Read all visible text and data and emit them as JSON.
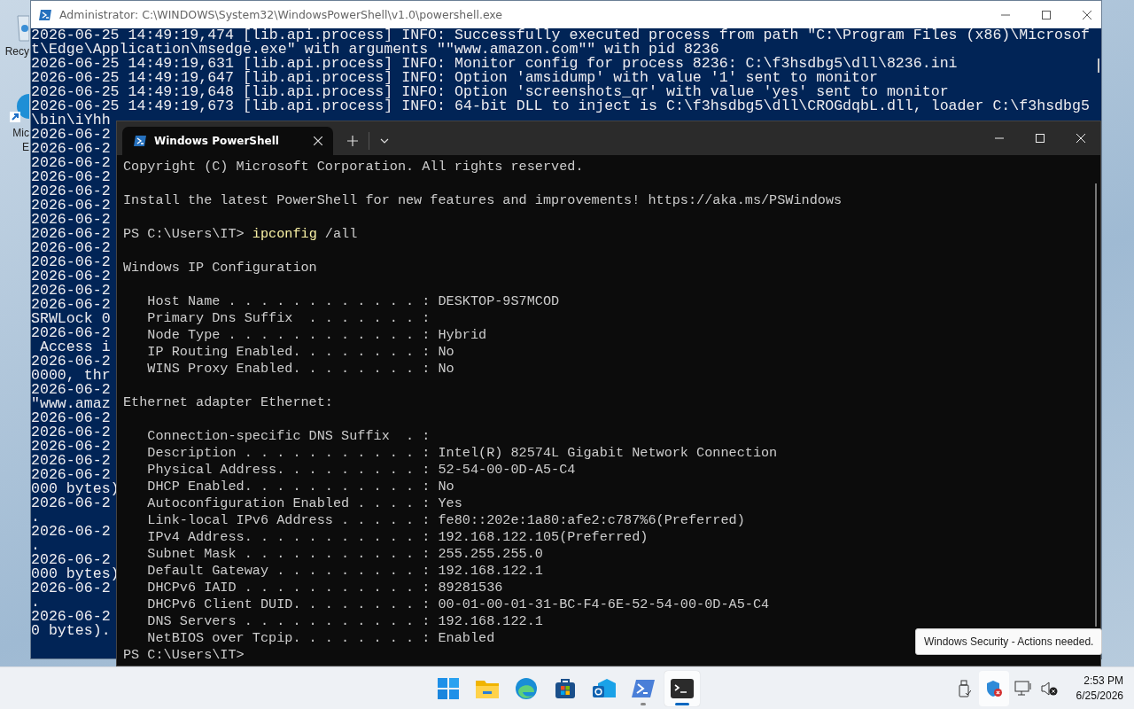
{
  "desktop_icons": [
    {
      "kind": "recycle",
      "lines": [
        "Recy"
      ]
    },
    {
      "kind": "edge",
      "lines": [
        "Mic",
        "E"
      ]
    }
  ],
  "console_window": {
    "title": "Administrator: C:\\WINDOWS\\System32\\WindowsPowerShell\\v1.0\\powershell.exe",
    "lines": [
      "2026-06-25 14:49:19,474 [lib.api.process] INFO: Successfully executed process from path \"C:\\Program Files (x86)\\Microsof",
      "t\\Edge\\Application\\msedge.exe\" with arguments \"\"www.amazon.com\"\" with pid 8236",
      "2026-06-25 14:49:19,631 [lib.api.process] INFO: Monitor config for process 8236: C:\\f3hsdbg5\\dll\\8236.ini",
      "2026-06-25 14:49:19,647 [lib.api.process] INFO: Option 'amsidump' with value '1' sent to monitor",
      "2026-06-25 14:49:19,648 [lib.api.process] INFO: Option 'screenshots_qr' with value 'yes' sent to monitor",
      "2026-06-25 14:49:19,673 [lib.api.process] INFO: 64-bit DLL to inject is C:\\f3hsdbg5\\dll\\CROGdqbL.dll, loader C:\\f3hsdbg5",
      "\\bin\\iYhh",
      "2026-06-2",
      "2026-06-2",
      "2026-06-2",
      "2026-06-2",
      "2026-06-2",
      "2026-06-2",
      "2026-06-2",
      "2026-06-2",
      "2026-06-2",
      "2026-06-2",
      "2026-06-2",
      "2026-06-2",
      "2026-06-2",
      "SRWLock 0",
      "2026-06-2",
      " Access i",
      "2026-06-2",
      "0000, thr",
      "2026-06-2",
      "\"www.amaz",
      "2026-06-2",
      "2026-06-2",
      "2026-06-2",
      "2026-06-2",
      "2026-06-2",
      "000 bytes)",
      "2026-06-2",
      ".",
      "2026-06-2",
      ".",
      "2026-06-2",
      "000 bytes)",
      "2026-06-2",
      ".",
      "2026-06-2",
      "0 bytes)."
    ]
  },
  "terminal": {
    "tab": {
      "label": "Windows PowerShell",
      "selected": true
    },
    "lines": [
      {
        "kind": "text",
        "text": "Copyright (C) Microsoft Corporation. All rights reserved."
      },
      {
        "kind": "blank"
      },
      {
        "kind": "text",
        "text": "Install the latest PowerShell for new features and improvements! https://aka.ms/PSWindows"
      },
      {
        "kind": "blank"
      },
      {
        "kind": "prompt",
        "prompt": "PS C:\\Users\\IT>",
        "command": "ipconfig",
        "args": "/all"
      },
      {
        "kind": "blank"
      },
      {
        "kind": "text",
        "text": "Windows IP Configuration"
      },
      {
        "kind": "blank"
      },
      {
        "kind": "text",
        "text": "   Host Name . . . . . . . . . . . . : DESKTOP-9S7MCOD"
      },
      {
        "kind": "text",
        "text": "   Primary Dns Suffix  . . . . . . . :"
      },
      {
        "kind": "text",
        "text": "   Node Type . . . . . . . . . . . . : Hybrid"
      },
      {
        "kind": "text",
        "text": "   IP Routing Enabled. . . . . . . . : No"
      },
      {
        "kind": "text",
        "text": "   WINS Proxy Enabled. . . . . . . . : No"
      },
      {
        "kind": "blank"
      },
      {
        "kind": "text",
        "text": "Ethernet adapter Ethernet:"
      },
      {
        "kind": "blank"
      },
      {
        "kind": "text",
        "text": "   Connection-specific DNS Suffix  . :"
      },
      {
        "kind": "text",
        "text": "   Description . . . . . . . . . . . : Intel(R) 82574L Gigabit Network Connection"
      },
      {
        "kind": "text",
        "text": "   Physical Address. . . . . . . . . : 52-54-00-0D-A5-C4"
      },
      {
        "kind": "text",
        "text": "   DHCP Enabled. . . . . . . . . . . : No"
      },
      {
        "kind": "text",
        "text": "   Autoconfiguration Enabled . . . . : Yes"
      },
      {
        "kind": "text",
        "text": "   Link-local IPv6 Address . . . . . : fe80::202e:1a80:afe2:c787%6(Preferred)"
      },
      {
        "kind": "text",
        "text": "   IPv4 Address. . . . . . . . . . . : 192.168.122.105(Preferred)"
      },
      {
        "kind": "text",
        "text": "   Subnet Mask . . . . . . . . . . . : 255.255.255.0"
      },
      {
        "kind": "text",
        "text": "   Default Gateway . . . . . . . . . : 192.168.122.1"
      },
      {
        "kind": "text",
        "text": "   DHCPv6 IAID . . . . . . . . . . . : 89281536"
      },
      {
        "kind": "text",
        "text": "   DHCPv6 Client DUID. . . . . . . . : 00-01-00-01-31-BC-F4-6E-52-54-00-0D-A5-C4"
      },
      {
        "kind": "text",
        "text": "   DNS Servers . . . . . . . . . . . : 192.168.122.1"
      },
      {
        "kind": "text",
        "text": "   NetBIOS over Tcpip. . . . . . . . : Enabled"
      },
      {
        "kind": "prompt",
        "prompt": "PS C:\\Users\\IT>"
      }
    ]
  },
  "toast": {
    "text": "Windows Security - Actions needed."
  },
  "taskbar": {
    "apps": [
      {
        "kind": "start",
        "running": false,
        "selected": false
      },
      {
        "kind": "explorer",
        "running": false,
        "selected": false
      },
      {
        "kind": "edge",
        "running": false,
        "selected": false
      },
      {
        "kind": "store",
        "running": false,
        "selected": false
      },
      {
        "kind": "outlook",
        "running": false,
        "selected": false
      },
      {
        "kind": "powershell",
        "running": true,
        "selected": false
      },
      {
        "kind": "terminal",
        "running": true,
        "selected": true
      }
    ],
    "tray": [
      {
        "kind": "usb",
        "selected": false
      },
      {
        "kind": "security",
        "selected": true
      },
      {
        "kind": "network",
        "selected": false
      },
      {
        "kind": "volume",
        "selected": false
      }
    ],
    "time": "2:53 PM",
    "date": "6/25/2026"
  }
}
